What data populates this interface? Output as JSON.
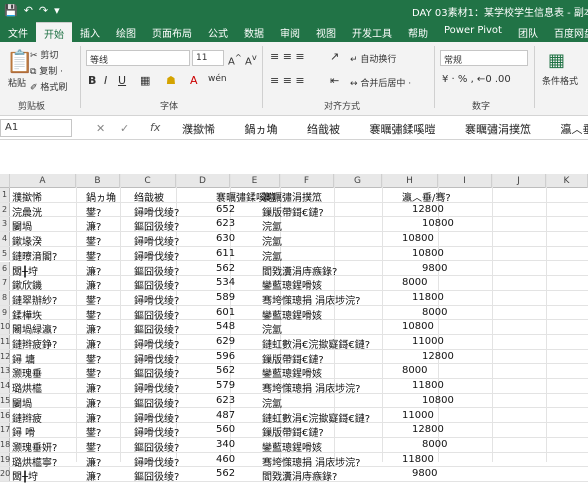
{
  "window": {
    "title": "DAY 03素材1：某学校学生信息表 - 副本.csv"
  },
  "tabs": [
    "文件",
    "开始",
    "插入",
    "绘图",
    "页面布局",
    "公式",
    "数据",
    "审阅",
    "视图",
    "开发工具",
    "帮助",
    "Power Pivot",
    "团队",
    "百度网盘"
  ],
  "ribbon": {
    "paste": "粘贴",
    "cut": "剪切",
    "copy": "复制 ·",
    "format_painter": "格式刷",
    "clipboard": "剪贴板",
    "font_name": "等线",
    "font_size": "11",
    "font_group": "字体",
    "wrap_text": "自动换行",
    "merge_center": "合并后居中 ·",
    "alignment_group": "对齐方式",
    "number_format": "常规",
    "number_group": "数字",
    "conditional_format": "条件格式"
  },
  "formula_bar": {
    "name_box": "A1",
    "fx": "fx",
    "content": [
      "濮撳悕",
      "鍋ヵ埆",
      "绉戠被",
      "褰曞彇鍒嗘暟",
      "褰曞彇涓撲笟",
      "瀛︿垂/骞?"
    ]
  },
  "columns": [
    "A",
    "B",
    "C",
    "D",
    "E",
    "F",
    "G",
    "H",
    "I",
    "J",
    "K"
  ],
  "rows": [
    {
      "n": "1",
      "cells": [
        "濮撳悕",
        "鍋ヵ埆",
        "绉戠被",
        "褰曞彇鍒嗘暟",
        "褰曞彇涓撲笟",
        "",
        "瀛︿垂/骞?"
      ]
    },
    {
      "n": "2",
      "cells": [
        "浣曟洸",
        "鐢?",
        "鐞嗗伐绫?",
        "652",
        "鏁版帶鎶€鏈?",
        "",
        "12800"
      ]
    },
    {
      "n": "3",
      "cells": [
        "闄堝",
        "濂?",
        "鏂囧彶绫?",
        "623",
        "浣氳",
        "",
        "10800"
      ]
    },
    {
      "n": "4",
      "cells": [
        "鏉堟湀",
        "鐢?",
        "鐞嗗伐绫?",
        "630",
        "浣氳",
        "",
        "10800"
      ]
    },
    {
      "n": "5",
      "cells": [
        "鏈曢湇閣?",
        "鐢?",
        "鐞嗗伐绫?",
        "611",
        "浣氳",
        "",
        "10800"
      ]
    },
    {
      "n": "6",
      "cells": [
        "闆╂垨",
        "濂?",
        "鏂囧彶绫?",
        "562",
        "閻戣瀵涓庤瘯錄?",
        "",
        "9800"
      ]
    },
    {
      "n": "7",
      "cells": [
        "鏉欣鐖",
        "濂?",
        "鏂囧彶绫?",
        "534",
        "鑾藍璁鍟嗗姟",
        "",
        "8000"
      ]
    },
    {
      "n": "8",
      "cells": [
        "鏈翠辦紗?",
        "鐢?",
        "鐞嗗伐绫?",
        "589",
        "骞垮憡璁捐  涓庡埗浣?",
        "",
        "11800"
      ]
    },
    {
      "n": "9",
      "cells": [
        "鍒樺垁",
        "鐢?",
        "鏂囧彶绫?",
        "601",
        "鑾藍璁鍟嗗姟",
        "",
        "8000"
      ]
    },
    {
      "n": "10",
      "cells": [
        "闂堝緑瀛?",
        "濂?",
        "鏂囧彶绫?",
        "548",
        "浣氳",
        "",
        "10800"
      ]
    },
    {
      "n": "11",
      "cells": [
        "鏈辫疲錚?",
        "濂?",
        "鐞嗗伐绫?",
        "629",
        "鏈虹數涓€浣撳寲鎶€鏈?",
        "",
        "11000"
      ]
    },
    {
      "n": "12",
      "cells": [
        "鐞  墉",
        "鐢?",
        "鐞嗗伐绫?",
        "596",
        "鏁版帶鎶€鏈?",
        "",
        "12800"
      ]
    },
    {
      "n": "13",
      "cells": [
        "灏瑰垂",
        "鐢?",
        "鏂囧彶绫?",
        "562",
        "鑾藍璁鍟嗗姟",
        "",
        "8000"
      ]
    },
    {
      "n": "14",
      "cells": [
        "璐烘櫙",
        "濂?",
        "鐞嗗伐绫?",
        "579",
        "骞垮憡璁捐  涓庡埗浣?",
        "",
        "11800"
      ]
    },
    {
      "n": "15",
      "cells": [
        "闄堝",
        "濂?",
        "鏂囧彶绫?",
        "623",
        "浣氳",
        "",
        "10800"
      ]
    },
    {
      "n": "16",
      "cells": [
        "鏈辫疲",
        "濂?",
        "鐞嗗伐绫?",
        "487",
        "鏈虹數涓€浣撳寲鎶€鏈?",
        "",
        "11000"
      ]
    },
    {
      "n": "17",
      "cells": [
        "鐞  嗗",
        "鐢?",
        "鐞嗗伐绫?",
        "560",
        "鏁版帶鎶€鏈?",
        "",
        "12800"
      ]
    },
    {
      "n": "18",
      "cells": [
        "灏瑰垂妍?",
        "鐢?",
        "鏂囧彶绫?",
        "340",
        "鑾藍璁鍟嗗姟",
        "",
        "8000"
      ]
    },
    {
      "n": "19",
      "cells": [
        "璐烘櫙寧?",
        "濂?",
        "鐞嗗伐绫?",
        "460",
        "骞垮憡璁捐  涓庡埗浣?",
        "",
        "11800"
      ]
    },
    {
      "n": "20",
      "cells": [
        "闆╂垨",
        "濂?",
        "鏂囧彶绫?",
        "562",
        "閻戣瀵涓庤瘯錄?",
        "",
        "9800"
      ]
    }
  ]
}
